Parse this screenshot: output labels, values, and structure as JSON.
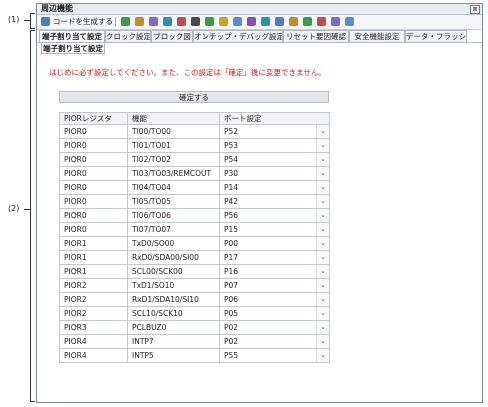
{
  "callouts": {
    "one": "(1)",
    "two": "(2)"
  },
  "window": {
    "title": "周辺機能",
    "close": "⊠"
  },
  "toolbar": {
    "generate_label": "コードを生成する",
    "icons": [
      "generate-icon",
      "clock-icon",
      "pin-icon",
      "timer-icon",
      "watchdog-icon",
      "display-icon",
      "interrupt-icon",
      "sound-icon",
      "key-icon",
      "comparator-icon",
      "serial-icon",
      "usb-icon",
      "lcd-icon",
      "dma-icon",
      "network-icon",
      "power-icon",
      "battery-icon",
      "pc-icon"
    ]
  },
  "tabs": [
    "端子割り当て設定",
    "クロック設定",
    "ブロック図",
    "オンチップ・デバッグ設定",
    "リセット要因確認",
    "安全機能設定",
    "データ・フラッシュ"
  ],
  "subtab": "端子割り当て設定",
  "notice": "はじめに必ず設定してください。また、この設定は「確定」後に変更できません。",
  "confirm_label": "確定する",
  "table": {
    "headers": [
      "PIORレジスタ",
      "機能",
      "ポート設定"
    ],
    "rows": [
      [
        "PIOR0",
        "TI00/TO00",
        "P52"
      ],
      [
        "PIOR0",
        "TI01/TO01",
        "P53"
      ],
      [
        "PIOR0",
        "TI02/TO02",
        "P54"
      ],
      [
        "PIOR0",
        "TI03/TO03/REMCOUT",
        "P30"
      ],
      [
        "PIOR0",
        "TI04/TO04",
        "P14"
      ],
      [
        "PIOR0",
        "TI05/TO05",
        "P42"
      ],
      [
        "PIOR0",
        "TI06/TO06",
        "P56"
      ],
      [
        "PIOR0",
        "TI07/TO07",
        "P15"
      ],
      [
        "PIOR1",
        "TxD0/SO00",
        "P00"
      ],
      [
        "PIOR1",
        "RxD0/SDA00/SI00",
        "P17"
      ],
      [
        "PIOR1",
        "SCL00/SCK00",
        "P16"
      ],
      [
        "PIOR2",
        "TxD1/SO10",
        "P07"
      ],
      [
        "PIOR2",
        "RxD1/SDA10/SI10",
        "P06"
      ],
      [
        "PIOR2",
        "SCL10/SCK10",
        "P05"
      ],
      [
        "PIOR3",
        "PCLBUZ0",
        "P02"
      ],
      [
        "PIOR4",
        "INTP7",
        "P02"
      ],
      [
        "PIOR4",
        "INTP5",
        "P55"
      ]
    ]
  }
}
